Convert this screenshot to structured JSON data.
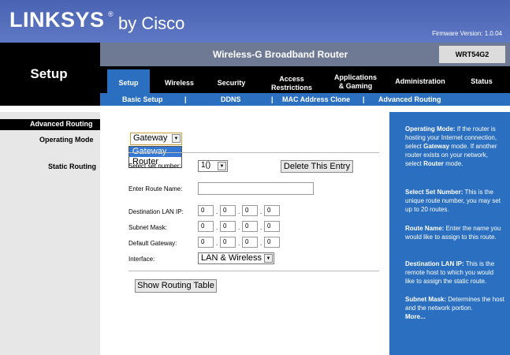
{
  "header": {
    "logo_main": "LINKSYS",
    "logo_reg": "®",
    "logo_sub": "by Cisco",
    "firmware": "Firmware Version: 1.0.04"
  },
  "product": {
    "name": "Wireless-G Broadband Router",
    "model": "WRT54G2"
  },
  "section_title": "Setup",
  "nav": [
    {
      "label": "Setup"
    },
    {
      "label": "Wireless"
    },
    {
      "label": "Security"
    },
    {
      "label": "Access\nRestrictions"
    },
    {
      "label": "Applications\n& Gaming"
    },
    {
      "label": "Administration"
    },
    {
      "label": "Status"
    }
  ],
  "subnav": [
    {
      "label": "Basic Setup"
    },
    {
      "label": "DDNS"
    },
    {
      "label": "MAC Address Clone"
    },
    {
      "label": "Advanced Routing"
    }
  ],
  "subnav_separators": [
    "|",
    "|",
    "|"
  ],
  "sidebar": {
    "section": "Advanced Routing",
    "operating_mode": "Operating Mode",
    "static_routing": "Static Routing"
  },
  "form": {
    "operating_mode_value": "Gateway",
    "dropdown_options": [
      "Gateway",
      "Router"
    ],
    "select_set_label": "Select set number:",
    "set_number_value": "1()",
    "delete_button": "Delete This Entry",
    "route_name_label": "Enter Route Name:",
    "route_name_value": "",
    "dest_ip_label": "Destination LAN IP:",
    "dest_ip": [
      "0",
      "0",
      "0",
      "0"
    ],
    "subnet_label": "Subnet Mask:",
    "subnet": [
      "0",
      "0",
      "0",
      "0"
    ],
    "gateway_label": "Default Gateway:",
    "gateway": [
      "0",
      "0",
      "0",
      "0"
    ],
    "interface_label": "Interface:",
    "interface_value": "LAN & Wireless",
    "dot": ".",
    "show_table_button": "Show Routing Table"
  },
  "help": [
    {
      "title": "Operating Mode:",
      "text": " If the router is hosting your Internet connection, select ",
      "bold2": "Gateway",
      "text2": " mode. If another router exists on your network, select ",
      "bold3": "Router",
      "text3": " mode."
    },
    {
      "title": "Select Set Number:",
      "text": " This is the unique route number, you may set up to 20 routes."
    },
    {
      "title": "Route Name:",
      "text": " Enter the name you would like to assign to this route."
    },
    {
      "title": "Destination LAN IP:",
      "text": " This is the remote host to which you would like to assign the static route."
    },
    {
      "title": "Subnet Mask:",
      "text": " Determines the host and the network portion."
    }
  ],
  "help_more": "More...",
  "colors": {
    "header_blue": "#4a63b3",
    "accent_blue": "#2b6fc0",
    "dark": "#000000",
    "sidebar_gray": "#e7e7e7"
  }
}
